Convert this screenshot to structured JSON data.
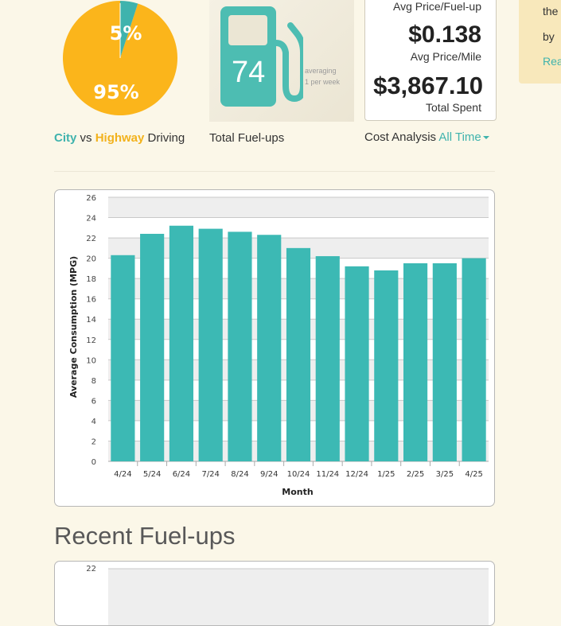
{
  "pie": {
    "slices": [
      {
        "name": "City",
        "percent": 5,
        "label": "5%",
        "color": "#3fb3ad"
      },
      {
        "name": "Highway",
        "percent": 95,
        "label": "95%",
        "color": "#fbb51b"
      }
    ],
    "caption": {
      "city": "City",
      "vs": "vs",
      "highway": "Highway",
      "driving": "Driving"
    }
  },
  "fuelups": {
    "count": "74",
    "averaging": "averaging",
    "rate": "1 per week",
    "caption": "Total Fuel-ups",
    "icon": "fuel-pump-icon"
  },
  "cost": {
    "fuelup_label": "Avg Price/Fuel-up",
    "mile_value": "$0.138",
    "mile_label": "Avg Price/Mile",
    "spent_value": "$3,867.10",
    "spent_label": "Total Spent",
    "caption_prefix": "Cost Analysis",
    "period": "All Time"
  },
  "sidebar": {
    "line1": "the",
    "line2": "by",
    "line3": "Rea"
  },
  "recent": {
    "title": "Recent Fuel-ups"
  },
  "chart_data": [
    {
      "type": "bar",
      "categories": [
        "4/24",
        "5/24",
        "6/24",
        "7/24",
        "8/24",
        "9/24",
        "10/24",
        "11/24",
        "12/24",
        "1/25",
        "2/25",
        "3/25",
        "4/25"
      ],
      "values": [
        20.3,
        22.4,
        23.2,
        22.9,
        22.6,
        22.3,
        21.0,
        20.2,
        19.2,
        18.8,
        19.5,
        19.5,
        20.0
      ],
      "xlabel": "Month",
      "ylabel": "Average Consumption (MPG)",
      "ylim": [
        0,
        26
      ],
      "yticks": [
        "0",
        "2",
        "4",
        "6",
        "8",
        "10",
        "12",
        "14",
        "16",
        "18",
        "20",
        "22",
        "24",
        "26"
      ],
      "bar_color": "#3cb9b4",
      "grid": true
    },
    {
      "type": "bar",
      "yticks": [
        "22"
      ]
    }
  ]
}
